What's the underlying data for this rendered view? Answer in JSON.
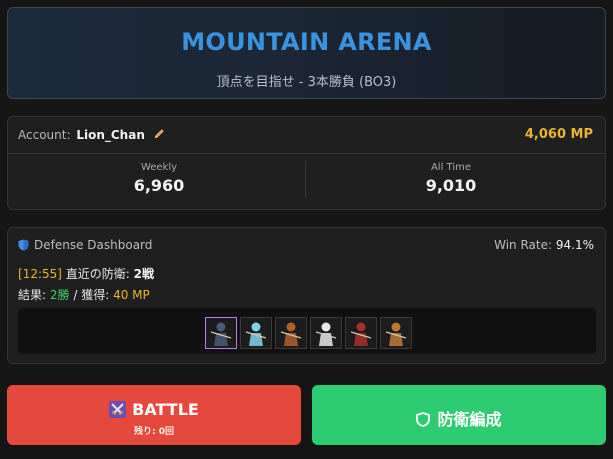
{
  "header": {
    "title": "MOUNTAIN ARENA",
    "subtitle": "頂点を目指せ - 3本勝負 (BO3)"
  },
  "account": {
    "label": "Account:",
    "name": "Lion_Chan",
    "mp": "4,060 MP",
    "weekly": {
      "label": "Weekly",
      "value": "6,960"
    },
    "all_time": {
      "label": "All Time",
      "value": "9,010"
    }
  },
  "defense": {
    "title": "Defense Dashboard",
    "win_rate_label": "Win Rate:",
    "win_rate_value": "94.1%",
    "last_time": "[12:55]",
    "last_defense_label": "直近の防衛:",
    "last_defense_value": "2戦",
    "result_label": "結果:",
    "result_value": "2勝",
    "separator": "/",
    "earned_label": "獲得:",
    "earned_value": "40 MP",
    "team": [
      {
        "name": "unit-1-icon",
        "color": "#4a5a7a"
      },
      {
        "name": "unit-2-icon",
        "color": "#7fd3ea"
      },
      {
        "name": "unit-3-icon",
        "color": "#b0602a"
      },
      {
        "name": "unit-4-icon",
        "color": "#e8e8ea"
      },
      {
        "name": "unit-5-icon",
        "color": "#a8302c"
      },
      {
        "name": "unit-6-icon",
        "color": "#c07838"
      }
    ]
  },
  "buttons": {
    "battle_label": "BATTLE",
    "battle_sub": "残り: 0回",
    "defense_label": "防衛編成"
  },
  "colors": {
    "accent_blue": "#3a93df",
    "gold": "#e9b52b",
    "battle_red": "#e5483d",
    "defense_green": "#2ecc71",
    "win_green": "#3fcf6a"
  }
}
